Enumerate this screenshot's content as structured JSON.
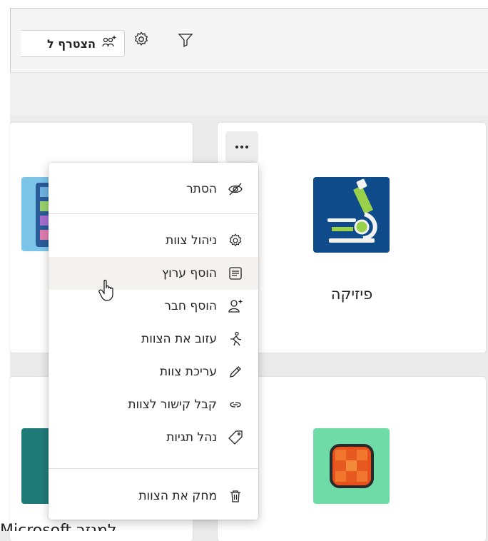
{
  "toolbar": {
    "join_label": "הצטרף ל",
    "icons": [
      "join-team-icon",
      "gear-icon",
      "filter-icon"
    ]
  },
  "teams": [
    {
      "name": "פיזיקה",
      "icon": "microscope-icon",
      "color": "#0f4a8a"
    },
    {
      "name": "",
      "icon": "orange-grid-icon",
      "color": "#6fdca8"
    }
  ],
  "bottom_partial_text": "Microsoft למנזר",
  "menu": {
    "items": [
      {
        "label": "הסתר",
        "icon": "eye-off-icon"
      },
      {
        "label": "ניהול צוות",
        "icon": "gear-icon"
      },
      {
        "label": "הוסף ערוץ",
        "icon": "channel-list-icon"
      },
      {
        "label": "הוסף חבר",
        "icon": "add-person-icon"
      },
      {
        "label": "עזוב את הצוות",
        "icon": "leave-walking-icon"
      },
      {
        "label": "עריכת צוות",
        "icon": "pencil-icon"
      },
      {
        "label": "קבל קישור לצוות",
        "icon": "link-icon"
      },
      {
        "label": "נהל תגיות",
        "icon": "tag-icon"
      },
      {
        "label": "מחק את הצוות",
        "icon": "trash-icon"
      }
    ],
    "hovered": "הוסף ערוץ"
  }
}
